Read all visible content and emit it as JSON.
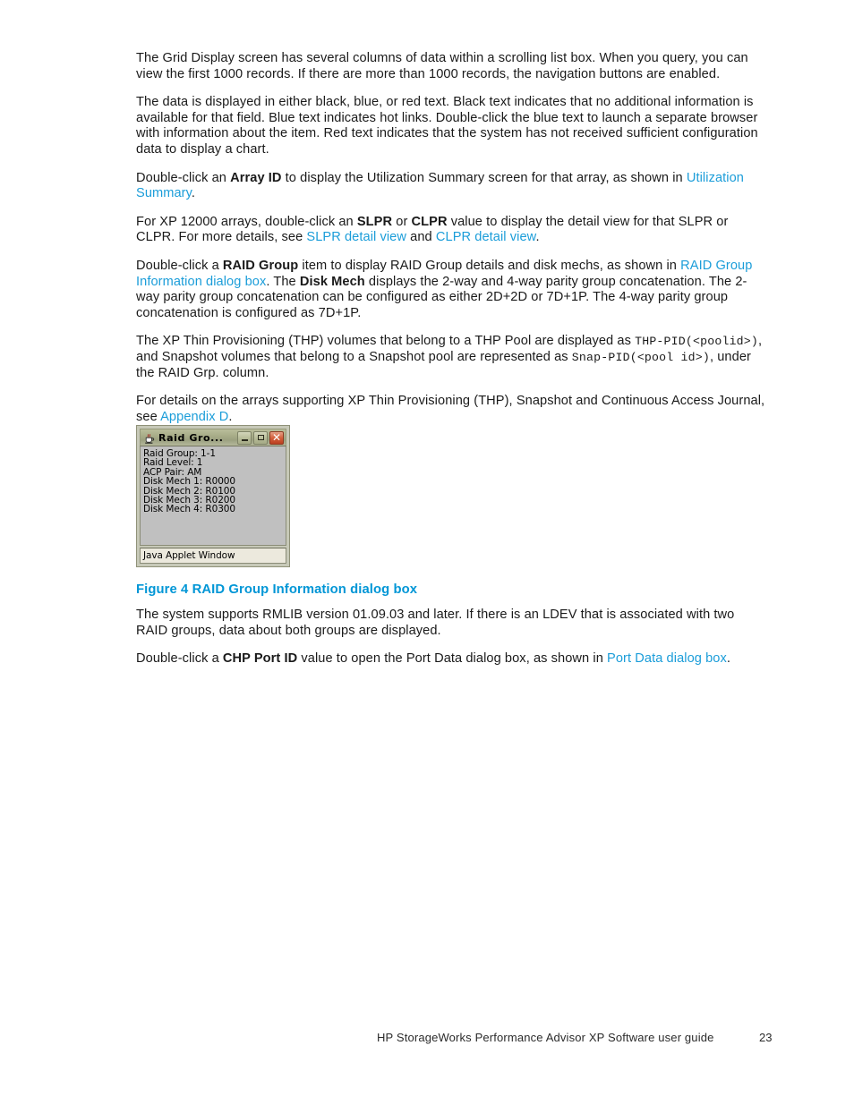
{
  "document": {
    "paragraphs": {
      "p1": "The Grid Display screen has several columns of data within a scrolling list box.  When you query, you can view the first 1000 records.  If there are more than 1000 records, the navigation buttons are enabled.",
      "p2": "The data is displayed in either black, blue, or red text.  Black text indicates that no additional information is available for that field.  Blue text indicates hot links.  Double-click the blue text to launch a separate browser with information about the item.  Red text indicates that the system has not received sufficient configuration data to display a chart.",
      "p3_a": "Double-click an ",
      "p3_bold": "Array ID",
      "p3_b": " to display the Utilization Summary screen for that array, as shown in ",
      "p3_link": "Utilization Summary",
      "p3_c": ".",
      "p4_a": "For XP 12000 arrays, double-click an ",
      "p4_bold1": "SLPR",
      "p4_b": " or ",
      "p4_bold2": "CLPR",
      "p4_c": " value to display the detail view for that SLPR or CLPR.  For more details, see ",
      "p4_link1": "SLPR detail view",
      "p4_d": " and ",
      "p4_link2": "CLPR detail view",
      "p4_e": ".",
      "p5_a": "Double-click a ",
      "p5_bold1": "RAID Group",
      "p5_b": " item to display RAID Group details and disk mechs, as shown in ",
      "p5_link": "RAID Group Information dialog box",
      "p5_c": ".  The ",
      "p5_bold2": "Disk Mech",
      "p5_d": " displays the 2-way and 4-way parity group concatenation.  The 2-way parity group concatenation can be configured as either 2D+2D or 7D+1P. The 4-way parity group concatenation is configured as 7D+1P.",
      "p6_a": "The XP Thin Provisioning (THP) volumes that belong to a THP Pool are displayed as ",
      "p6_mono1": "THP-PID(<poolid>)",
      "p6_b": ", and Snapshot volumes that belong to a Snapshot pool are represented as ",
      "p6_mono2": "Snap-PID(<pool id>)",
      "p6_c": ", under the RAID Grp.  column.",
      "p7_a": "For details on the arrays supporting XP Thin Provisioning (THP), Snapshot and Continuous Access Journal, see ",
      "p7_link": "Appendix D",
      "p7_b": ".",
      "p8": "The system supports RMLIB version 01.09.03 and later.  If there is an LDEV that is associated with two RAID groups, data about both groups are displayed.",
      "p9_a": "Double-click a ",
      "p9_bold": "CHP Port ID",
      "p9_b": " value to open the Port Data dialog box, as shown in ",
      "p9_link": "Port Data dialog box",
      "p9_c": "."
    },
    "caption": "Figure 4 RAID Group Information dialog box",
    "footer": {
      "title": "HP StorageWorks Performance Advisor XP Software user guide",
      "page_number": "23"
    },
    "colors": {
      "link_blue": "#1b9dd9",
      "caption_blue": "#0096d6",
      "body_text": "#1a1a1a"
    }
  },
  "figure_dialog": {
    "title": "Raid Gro...",
    "window_buttons": {
      "minimize": "Minimize",
      "maximize": "Maximize",
      "close": "Close"
    },
    "info_lines": [
      "Raid Group: 1-1",
      "Raid Level: 1",
      "ACP Pair: AM",
      "Disk Mech 1: R0000",
      "Disk Mech 2: R0100",
      "Disk Mech 3: R0200",
      "Disk Mech 4: R0300"
    ],
    "status_bar": "Java Applet Window"
  }
}
